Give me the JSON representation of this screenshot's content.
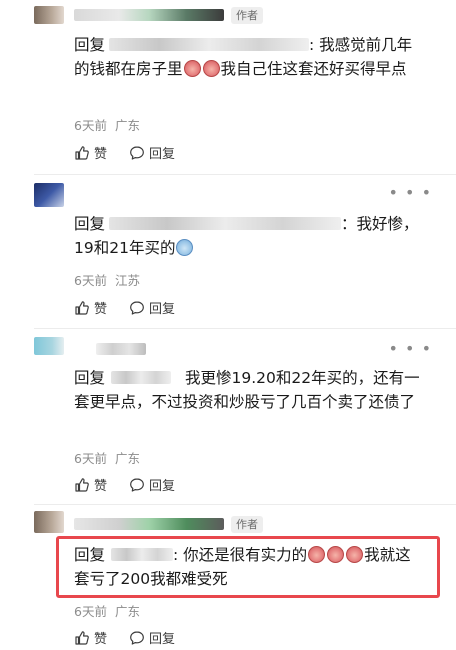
{
  "labels": {
    "reply": "回复",
    "like": "赞",
    "reply_action": "回复",
    "author": "作者"
  },
  "colors": {
    "highlight_border": "#e8474d",
    "meta_text": "#8c8c8c"
  },
  "comments": [
    {
      "author_badge": "作者",
      "text_after": ": 我感觉前几年的钱都在房子里",
      "text_tail": "我自己住这套还好买得早点",
      "time": "6天前",
      "location": "广东"
    },
    {
      "text_after": "：我好惨，19和21年买的",
      "time": "6天前",
      "location": "江苏"
    },
    {
      "text_after": "我更惨19.20和22年买的，还有一套更早点，不过投资和炒股亏了几百个卖了还债了",
      "time": "6天前",
      "location": "广东"
    },
    {
      "author_badge": "作者",
      "text_after": ": 你还是很有实力的",
      "text_tail": "我就这套亏了200我都难受死",
      "time": "6天前",
      "location": "广东"
    }
  ]
}
